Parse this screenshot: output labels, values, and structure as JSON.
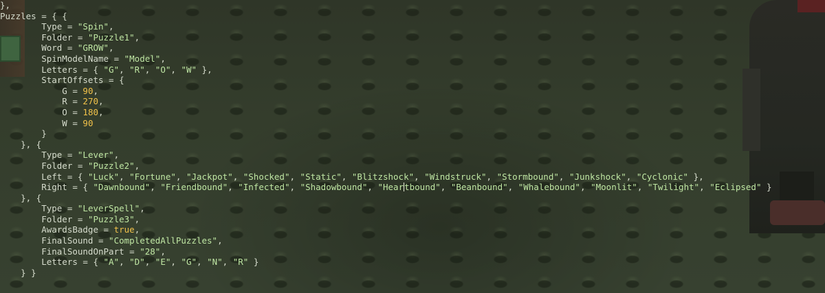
{
  "code_lines": [
    [
      {
        "t": "p",
        "v": "},"
      }
    ],
    [
      {
        "t": "p",
        "v": "Puzzles = { {"
      }
    ],
    [
      {
        "t": "p",
        "v": "        Type = "
      },
      {
        "t": "s",
        "v": "\"Spin\""
      },
      {
        "t": "p",
        "v": ","
      }
    ],
    [
      {
        "t": "p",
        "v": "        Folder = "
      },
      {
        "t": "s",
        "v": "\"Puzzle1\""
      },
      {
        "t": "p",
        "v": ","
      }
    ],
    [
      {
        "t": "p",
        "v": "        Word = "
      },
      {
        "t": "s",
        "v": "\"GROW\""
      },
      {
        "t": "p",
        "v": ","
      }
    ],
    [
      {
        "t": "p",
        "v": "        SpinModelName = "
      },
      {
        "t": "s",
        "v": "\"Model\""
      },
      {
        "t": "p",
        "v": ","
      }
    ],
    [
      {
        "t": "p",
        "v": "        Letters = { "
      },
      {
        "t": "s",
        "v": "\"G\""
      },
      {
        "t": "p",
        "v": ", "
      },
      {
        "t": "s",
        "v": "\"R\""
      },
      {
        "t": "p",
        "v": ", "
      },
      {
        "t": "s",
        "v": "\"O\""
      },
      {
        "t": "p",
        "v": ", "
      },
      {
        "t": "s",
        "v": "\"W\""
      },
      {
        "t": "p",
        "v": " },"
      }
    ],
    [
      {
        "t": "p",
        "v": "        StartOffsets = {"
      }
    ],
    [
      {
        "t": "p",
        "v": "            G = "
      },
      {
        "t": "n",
        "v": "90"
      },
      {
        "t": "p",
        "v": ","
      }
    ],
    [
      {
        "t": "p",
        "v": "            R = "
      },
      {
        "t": "n",
        "v": "270"
      },
      {
        "t": "p",
        "v": ","
      }
    ],
    [
      {
        "t": "p",
        "v": "            O = "
      },
      {
        "t": "n",
        "v": "180"
      },
      {
        "t": "p",
        "v": ","
      }
    ],
    [
      {
        "t": "p",
        "v": "            W = "
      },
      {
        "t": "n",
        "v": "90"
      }
    ],
    [
      {
        "t": "p",
        "v": "        }"
      }
    ],
    [
      {
        "t": "p",
        "v": "    }, {"
      }
    ],
    [
      {
        "t": "p",
        "v": "        Type = "
      },
      {
        "t": "s",
        "v": "\"Lever\""
      },
      {
        "t": "p",
        "v": ","
      }
    ],
    [
      {
        "t": "p",
        "v": "        Folder = "
      },
      {
        "t": "s",
        "v": "\"Puzzle2\""
      },
      {
        "t": "p",
        "v": ","
      }
    ],
    [
      {
        "t": "p",
        "v": "        Left = { "
      },
      {
        "t": "s",
        "v": "\"Luck\""
      },
      {
        "t": "p",
        "v": ", "
      },
      {
        "t": "s",
        "v": "\"Fortune\""
      },
      {
        "t": "p",
        "v": ", "
      },
      {
        "t": "s",
        "v": "\"Jackpot\""
      },
      {
        "t": "p",
        "v": ", "
      },
      {
        "t": "s",
        "v": "\"Shocked\""
      },
      {
        "t": "p",
        "v": ", "
      },
      {
        "t": "s",
        "v": "\"Static\""
      },
      {
        "t": "p",
        "v": ", "
      },
      {
        "t": "s",
        "v": "\"Blitzshock\""
      },
      {
        "t": "p",
        "v": ", "
      },
      {
        "t": "s",
        "v": "\"Windstruck\""
      },
      {
        "t": "p",
        "v": ", "
      },
      {
        "t": "s",
        "v": "\"Stormbound\""
      },
      {
        "t": "p",
        "v": ", "
      },
      {
        "t": "s",
        "v": "\"Junkshock\""
      },
      {
        "t": "p",
        "v": ", "
      },
      {
        "t": "s",
        "v": "\"Cyclonic\""
      },
      {
        "t": "p",
        "v": " },"
      }
    ],
    [
      {
        "t": "p",
        "v": "        Right = { "
      },
      {
        "t": "s",
        "v": "\"Dawnbound\""
      },
      {
        "t": "p",
        "v": ", "
      },
      {
        "t": "s",
        "v": "\"Friendbound\""
      },
      {
        "t": "p",
        "v": ", "
      },
      {
        "t": "s",
        "v": "\"Infected\""
      },
      {
        "t": "p",
        "v": ", "
      },
      {
        "t": "s",
        "v": "\"Shadowbound\""
      },
      {
        "t": "p",
        "v": ", "
      },
      {
        "t": "s",
        "v": "\"Hear"
      },
      {
        "t": "c",
        "v": ""
      },
      {
        "t": "s",
        "v": "tbound\""
      },
      {
        "t": "p",
        "v": ", "
      },
      {
        "t": "s",
        "v": "\"Beanbound\""
      },
      {
        "t": "p",
        "v": ", "
      },
      {
        "t": "s",
        "v": "\"Whalebound\""
      },
      {
        "t": "p",
        "v": ", "
      },
      {
        "t": "s",
        "v": "\"Moonlit\""
      },
      {
        "t": "p",
        "v": ", "
      },
      {
        "t": "s",
        "v": "\"Twilight\""
      },
      {
        "t": "p",
        "v": ", "
      },
      {
        "t": "s",
        "v": "\"Eclipsed\""
      },
      {
        "t": "p",
        "v": " }"
      }
    ],
    [
      {
        "t": "p",
        "v": "    }, {"
      }
    ],
    [
      {
        "t": "p",
        "v": "        Type = "
      },
      {
        "t": "s",
        "v": "\"LeverSpell\""
      },
      {
        "t": "p",
        "v": ","
      }
    ],
    [
      {
        "t": "p",
        "v": "        Folder = "
      },
      {
        "t": "s",
        "v": "\"Puzzle3\""
      },
      {
        "t": "p",
        "v": ","
      }
    ],
    [
      {
        "t": "p",
        "v": "        AwardsBadge = "
      },
      {
        "t": "b",
        "v": "true"
      },
      {
        "t": "p",
        "v": ","
      }
    ],
    [
      {
        "t": "p",
        "v": "        FinalSound = "
      },
      {
        "t": "s",
        "v": "\"CompletedAllPuzzles\""
      },
      {
        "t": "p",
        "v": ","
      }
    ],
    [
      {
        "t": "p",
        "v": "        FinalSoundOnPart = "
      },
      {
        "t": "s",
        "v": "\"28\""
      },
      {
        "t": "p",
        "v": ","
      }
    ],
    [
      {
        "t": "p",
        "v": "        Letters = { "
      },
      {
        "t": "s",
        "v": "\"A\""
      },
      {
        "t": "p",
        "v": ", "
      },
      {
        "t": "s",
        "v": "\"D\""
      },
      {
        "t": "p",
        "v": ", "
      },
      {
        "t": "s",
        "v": "\"E\""
      },
      {
        "t": "p",
        "v": ", "
      },
      {
        "t": "s",
        "v": "\"G\""
      },
      {
        "t": "p",
        "v": ", "
      },
      {
        "t": "s",
        "v": "\"N\""
      },
      {
        "t": "p",
        "v": ", "
      },
      {
        "t": "s",
        "v": "\"R\""
      },
      {
        "t": "p",
        "v": " }"
      }
    ],
    [
      {
        "t": "p",
        "v": "    } }"
      }
    ]
  ],
  "colors": {
    "plain": "#d6dccd",
    "string": "#bfe6a3",
    "number": "#f2c24a",
    "boolean": "#f2c24a",
    "background": "#343d2c"
  }
}
